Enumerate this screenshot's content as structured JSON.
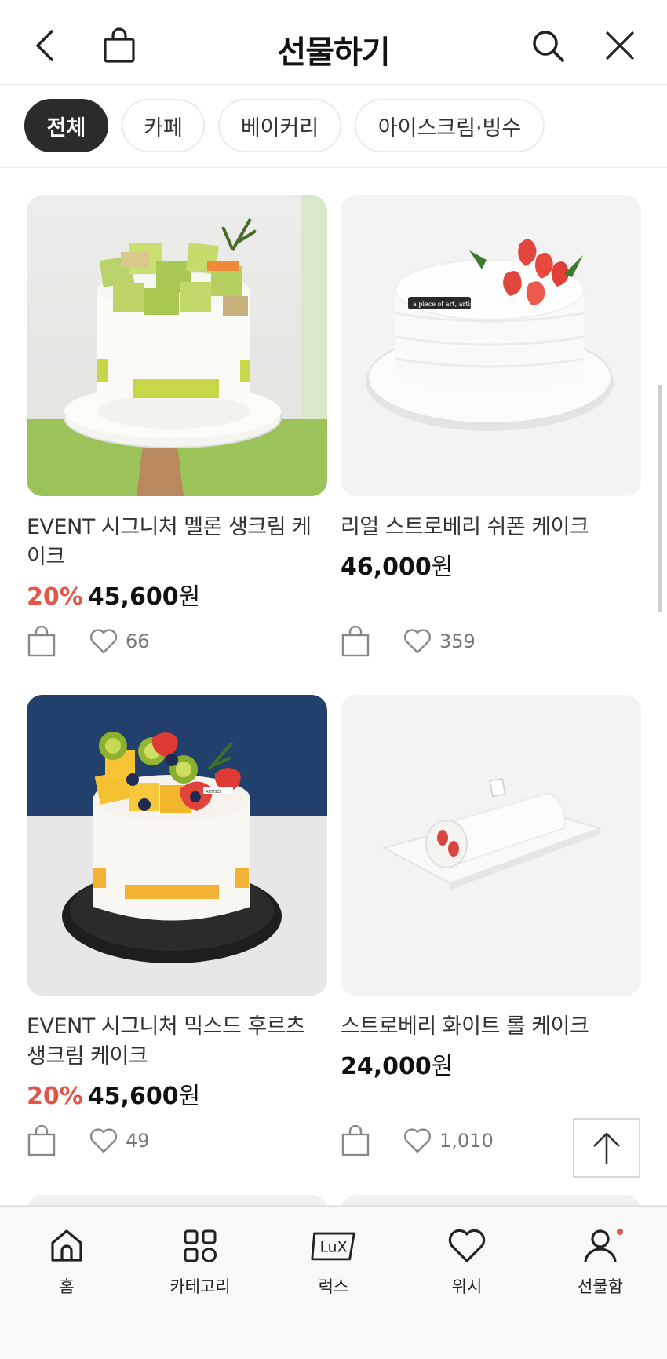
{
  "header": {
    "title": "선물하기",
    "back_icon": "chevron-left-icon",
    "bag_icon": "shopping-bag-icon",
    "search_icon": "search-icon",
    "close_icon": "close-icon"
  },
  "filters": [
    {
      "label": "전체",
      "active": true
    },
    {
      "label": "카페",
      "active": false
    },
    {
      "label": "베이커리",
      "active": false
    },
    {
      "label": "아이스크림·빙수",
      "active": false
    }
  ],
  "products": [
    {
      "name": "EVENT 시그니처 멜론 생크림 케이크",
      "discount": "20%",
      "price": "45,600",
      "currency": "원",
      "likes": "66"
    },
    {
      "name": "리얼 스트로베리 쉬폰 케이크",
      "discount": "",
      "price": "46,000",
      "currency": "원",
      "likes": "359"
    },
    {
      "name": "EVENT 시그니처 믹스드 후르츠 생크림 케이크",
      "discount": "20%",
      "price": "45,600",
      "currency": "원",
      "likes": "49"
    },
    {
      "name": "스트로베리 화이트 롤 케이크",
      "discount": "",
      "price": "24,000",
      "currency": "원",
      "likes": "1,010"
    }
  ],
  "image_labels": {
    "cake_tag": "a piece of art, artisée",
    "cake_tag_short": "ARTISÉE"
  },
  "bottom_nav": [
    {
      "label": "홈",
      "icon": "home-icon"
    },
    {
      "label": "카테고리",
      "icon": "category-grid-icon"
    },
    {
      "label": "럭스",
      "icon": "lux-icon",
      "icon_text": "LuX"
    },
    {
      "label": "위시",
      "icon": "heart-icon"
    },
    {
      "label": "선물함",
      "icon": "user-icon",
      "has_notification": true
    }
  ],
  "colors": {
    "accent_red": "#e2564a",
    "active_chip": "#2b2b2b",
    "text_primary": "#111111"
  }
}
